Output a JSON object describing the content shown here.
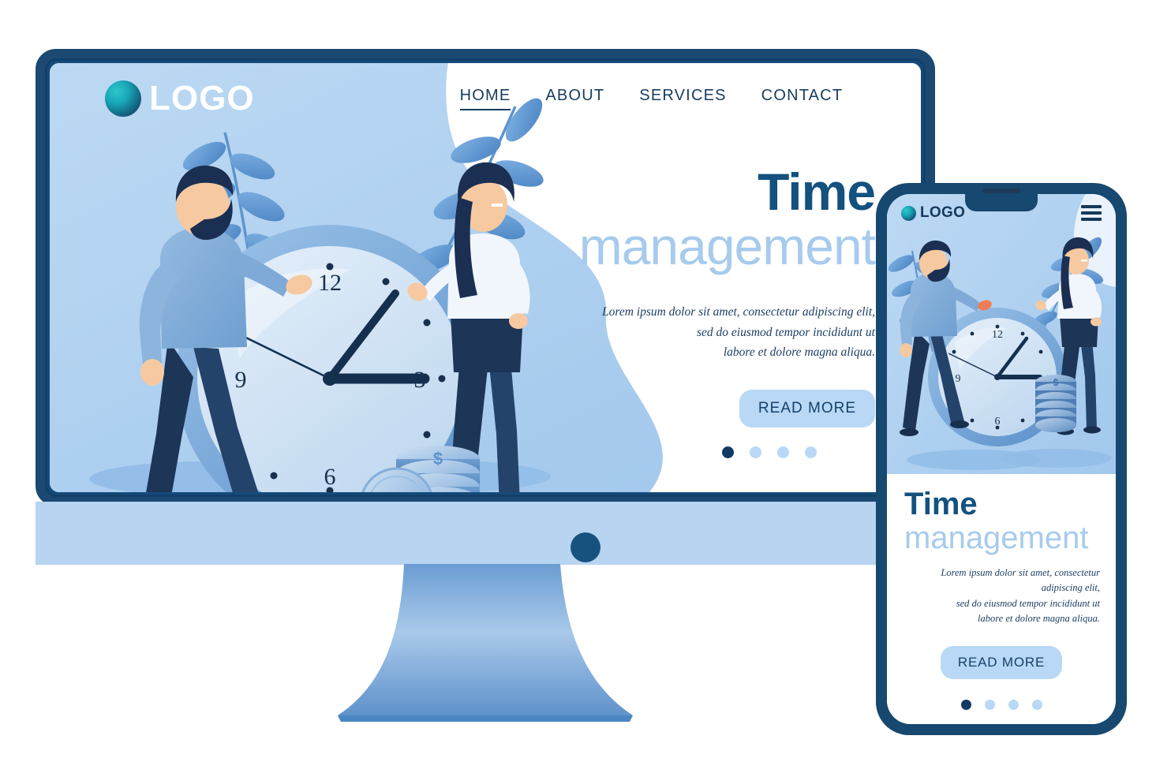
{
  "brand": {
    "logo_text": "LOGO",
    "logo_icon": "gradient-circle-icon",
    "accent_dark": "#13517f",
    "accent_light": "#a7cbed",
    "button_bg": "#b9d8f5",
    "frame_color": "#17486f"
  },
  "desktop": {
    "nav": [
      {
        "label": "HOME",
        "active": true
      },
      {
        "label": "ABOUT",
        "active": false
      },
      {
        "label": "SERVICES",
        "active": false
      },
      {
        "label": "CONTACT",
        "active": false
      }
    ],
    "heading_line1": "Time",
    "heading_line2": "management",
    "paragraph_line1": "Lorem ipsum dolor sit amet, consectetur adipiscing elit,",
    "paragraph_line2": "sed do eiusmod tempor incididunt ut",
    "paragraph_line3": "labore et dolore magna aliqua.",
    "cta_label": "READ MORE",
    "carousel_dots": 4,
    "carousel_active_index": 0
  },
  "phone": {
    "logo_text": "LOGO",
    "menu_icon": "hamburger-menu-icon",
    "heading_line1": "Time",
    "heading_line2": "management",
    "paragraph_line1": "Lorem ipsum dolor sit amet, consectetur adipiscing elit,",
    "paragraph_line2": "sed do eiusmod tempor incididunt ut",
    "paragraph_line3": "labore et dolore magna aliqua.",
    "cta_label": "READ MORE",
    "carousel_dots": 4,
    "carousel_active_index": 0
  },
  "illustration": {
    "clock_numbers": [
      "12",
      "3",
      "6",
      "9"
    ],
    "coin_symbol": "$",
    "characters": [
      "bearded-man",
      "woman-with-long-hair"
    ],
    "props": [
      "wall-clock",
      "coin-stack",
      "loose-coin",
      "leafy-branch"
    ]
  }
}
